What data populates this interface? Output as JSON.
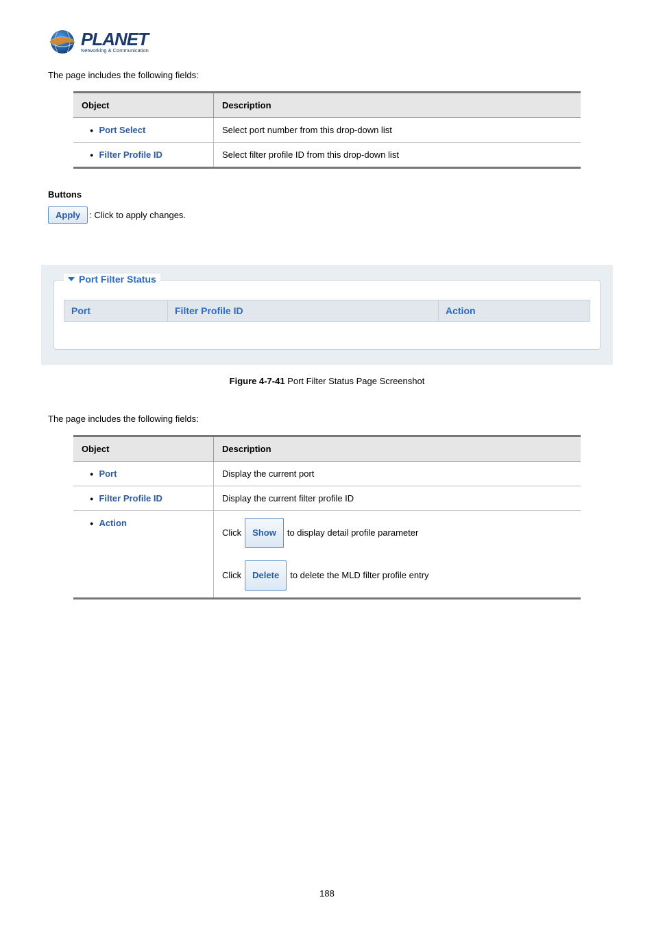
{
  "logo": {
    "main": "PLANET",
    "sub": "Networking & Communication"
  },
  "intro1": "The page includes the following fields:",
  "table1": {
    "headers": {
      "object": "Object",
      "description": "Description"
    },
    "rows": [
      {
        "name": "Port Select",
        "desc": "Select port number from this drop-down list"
      },
      {
        "name": "Filter Profile ID",
        "desc": "Select filter profile ID from this drop-down list"
      }
    ]
  },
  "buttons_heading": "Buttons",
  "apply": {
    "label": "Apply",
    "desc": ": Click to apply changes."
  },
  "panel": {
    "title": "Port Filter Status",
    "headers": {
      "port": "Port",
      "profile": "Filter Profile ID",
      "action": "Action"
    }
  },
  "caption": {
    "bold": "Figure 4-7-41",
    "rest": " Port Filter Status Page Screenshot"
  },
  "intro2": "The page includes the following fields:",
  "table2": {
    "headers": {
      "object": "Object",
      "description": "Description"
    },
    "rows": [
      {
        "name": "Port",
        "desc": "Display the current port"
      },
      {
        "name": "Filter Profile ID",
        "desc": "Display the current filter profile ID"
      }
    ],
    "action": {
      "name": "Action",
      "click": "Click",
      "show": {
        "label": "Show",
        "desc": " to display detail profile parameter"
      },
      "delete": {
        "label": "Delete",
        "desc": " to delete the MLD filter profile entry"
      }
    }
  },
  "page_number": "188"
}
